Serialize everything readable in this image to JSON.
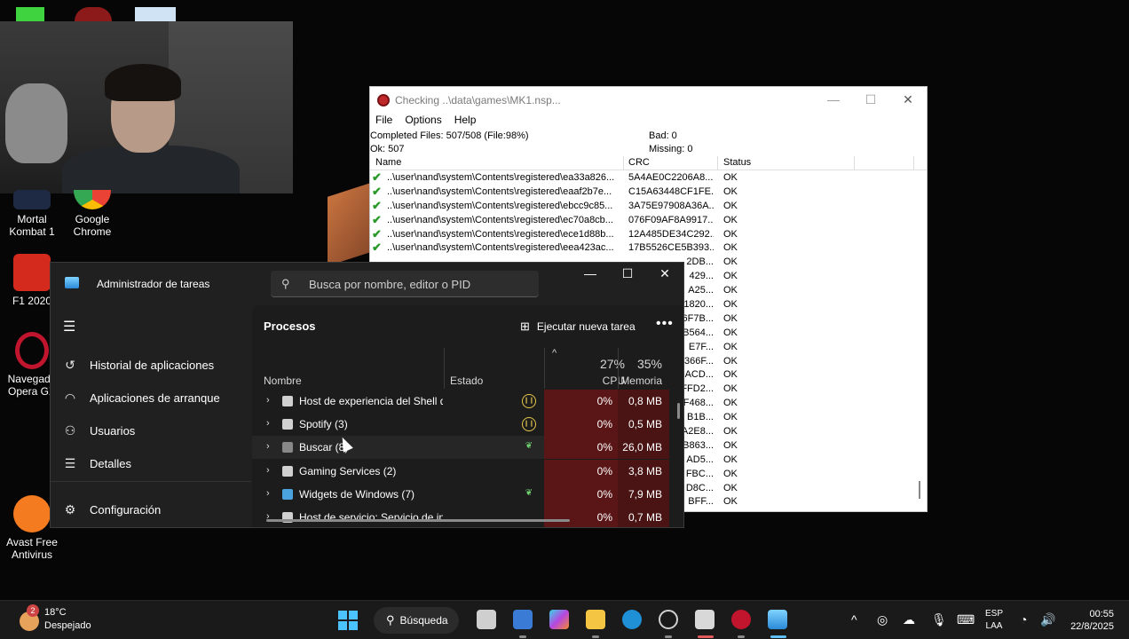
{
  "desktop_icons": [
    {
      "id": "mk1",
      "label_line1": "Mortal",
      "label_line2": "Kombat 1",
      "color": "#1e2a44"
    },
    {
      "id": "chrome",
      "label_line1": "Google",
      "label_line2": "Chrome",
      "color": "#f2c12e"
    },
    {
      "id": "f1",
      "label_line1": "F1 2020",
      "label_line2": "",
      "color": "#d42a1e"
    },
    {
      "id": "opera",
      "label_line1": "Navegado",
      "label_line2": "Opera GX",
      "color": "#c1142d"
    },
    {
      "id": "avast",
      "label_line1": "Avast Free",
      "label_line2": "Antivirus",
      "color": "#f47b20"
    }
  ],
  "checker": {
    "title": "Checking ..\\data\\games\\MK1.nsp...",
    "menu": [
      "File",
      "Options",
      "Help"
    ],
    "completed": "Completed Files: 507/508 (File:98%)",
    "ok": "Ok: 507",
    "bad": "Bad: 0",
    "missing": "Missing: 0",
    "columns": {
      "name": "Name",
      "crc": "CRC",
      "status": "Status"
    },
    "rows": [
      {
        "name": "..\\user\\nand\\system\\Contents\\registered\\ea33a826...",
        "crc": "5A4AE0C2206A8...",
        "status": "OK"
      },
      {
        "name": "..\\user\\nand\\system\\Contents\\registered\\eaaf2b7e...",
        "crc": "C15A63448CF1FE...",
        "status": "OK"
      },
      {
        "name": "..\\user\\nand\\system\\Contents\\registered\\ebcc9c85...",
        "crc": "3A75E97908A36A...",
        "status": "OK"
      },
      {
        "name": "..\\user\\nand\\system\\Contents\\registered\\ec70a8cb...",
        "crc": "076F09AF8A9917...",
        "status": "OK"
      },
      {
        "name": "..\\user\\nand\\system\\Contents\\registered\\ece1d88b...",
        "crc": "12A485DE34C292...",
        "status": "OK"
      },
      {
        "name": "..\\user\\nand\\system\\Contents\\registered\\eea423ac...",
        "crc": "17B5526CE5B393...",
        "status": "OK"
      },
      {
        "name": "",
        "crc": "2DB...",
        "status": "OK"
      },
      {
        "name": "",
        "crc": "429...",
        "status": "OK"
      },
      {
        "name": "",
        "crc": "A25...",
        "status": "OK"
      },
      {
        "name": "",
        "crc": "1820...",
        "status": "OK"
      },
      {
        "name": "",
        "crc": "6F7B...",
        "status": "OK"
      },
      {
        "name": "",
        "crc": "B564...",
        "status": "OK"
      },
      {
        "name": "",
        "crc": "E7F...",
        "status": "OK"
      },
      {
        "name": "",
        "crc": "366F...",
        "status": "OK"
      },
      {
        "name": "",
        "crc": "ACD...",
        "status": "OK"
      },
      {
        "name": "",
        "crc": "FFD2...",
        "status": "OK"
      },
      {
        "name": "",
        "crc": "F468...",
        "status": "OK"
      },
      {
        "name": "",
        "crc": "B1B...",
        "status": "OK"
      },
      {
        "name": "",
        "crc": "A2E8...",
        "status": "OK"
      },
      {
        "name": "",
        "crc": "B863...",
        "status": "OK"
      },
      {
        "name": "",
        "crc": "AD5...",
        "status": "OK"
      },
      {
        "name": "",
        "crc": "FBC...",
        "status": "OK"
      },
      {
        "name": "",
        "crc": "D8C...",
        "status": "OK"
      },
      {
        "name": "",
        "crc": "BFF...",
        "status": "OK"
      }
    ]
  },
  "taskmgr": {
    "title": "Administrador de tareas",
    "search_placeholder": "Busca por nombre, editor o PID",
    "nav": [
      {
        "label": "Historial de aplicaciones",
        "icon": "history-icon"
      },
      {
        "label": "Aplicaciones de arranque",
        "icon": "speedometer-icon"
      },
      {
        "label": "Usuarios",
        "icon": "users-icon"
      },
      {
        "label": "Detalles",
        "icon": "list-icon"
      }
    ],
    "settings_label": "Configuración",
    "section_title": "Procesos",
    "new_task_label": "Ejecutar nueva tarea",
    "columns": {
      "name": "Nombre",
      "status": "Estado",
      "cpu_pct": "27%",
      "cpu": "CPU",
      "mem_pct": "35%",
      "mem": "Memoria"
    },
    "processes": [
      {
        "name": "Host de experiencia del Shell d...",
        "status_icon": "pause-icon",
        "cpu": "0%",
        "mem": "0,8 MB",
        "icon_color": "#d0d0d0"
      },
      {
        "name": "Spotify (3)",
        "status_icon": "pause-icon",
        "cpu": "0%",
        "mem": "0,5 MB",
        "icon_color": "#d0d0d0"
      },
      {
        "name": "Buscar (8)",
        "status_icon": "leaf-icon",
        "cpu": "0%",
        "mem": "26,0 MB",
        "icon_color": "#888888"
      },
      {
        "name": "Gaming Services (2)",
        "status_icon": "",
        "cpu": "0%",
        "mem": "3,8 MB",
        "icon_color": "#d0d0d0"
      },
      {
        "name": "Widgets de Windows (7)",
        "status_icon": "leaf-icon",
        "cpu": "0%",
        "mem": "7,9 MB",
        "icon_color": "#4aa3df"
      },
      {
        "name": "Host de servicio: Servicio de in...",
        "status_icon": "",
        "cpu": "0%",
        "mem": "0,7 MB",
        "icon_color": "#d0d0d0"
      }
    ]
  },
  "taskbar": {
    "temp": "18°C",
    "weather": "Despejado",
    "badge": "2",
    "search_label": "Búsqueda",
    "lang1": "ESP",
    "lang2": "LAA",
    "time": "00:55",
    "date": "22/8/2025"
  }
}
